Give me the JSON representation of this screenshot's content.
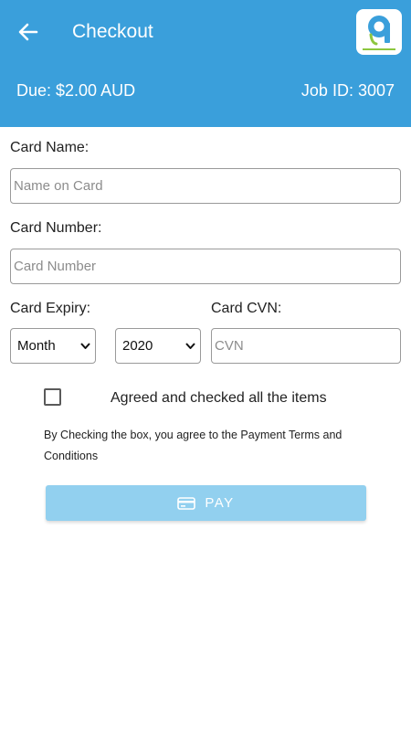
{
  "colors": {
    "header_bg": "#3a9fdb",
    "pay_button_bg": "#92d0ef",
    "logo_accent": "#8dc63f"
  },
  "header": {
    "back_icon": "arrow-left-icon",
    "title": "Checkout",
    "logo_icon": "brand-logo-icon",
    "due": "Due: $2.00 AUD",
    "job_id": "Job ID: 3007"
  },
  "form": {
    "card_name": {
      "label": "Card Name:",
      "placeholder": "Name on Card",
      "value": ""
    },
    "card_number": {
      "label": "Card Number:",
      "placeholder": "Card Number",
      "value": ""
    },
    "expiry": {
      "label": "Card Expiry:",
      "month": "Month",
      "year": "2020",
      "chevron_icon": "chevron-down-icon"
    },
    "cvn": {
      "label": "Card CVN:",
      "placeholder": "CVN",
      "value": ""
    },
    "agree": {
      "checked": false,
      "label": "Agreed and checked all the items"
    },
    "terms": "By Checking the box, you agree to the Payment Terms and Conditions",
    "pay_button": {
      "label": "PAY",
      "icon": "credit-card-icon"
    }
  }
}
